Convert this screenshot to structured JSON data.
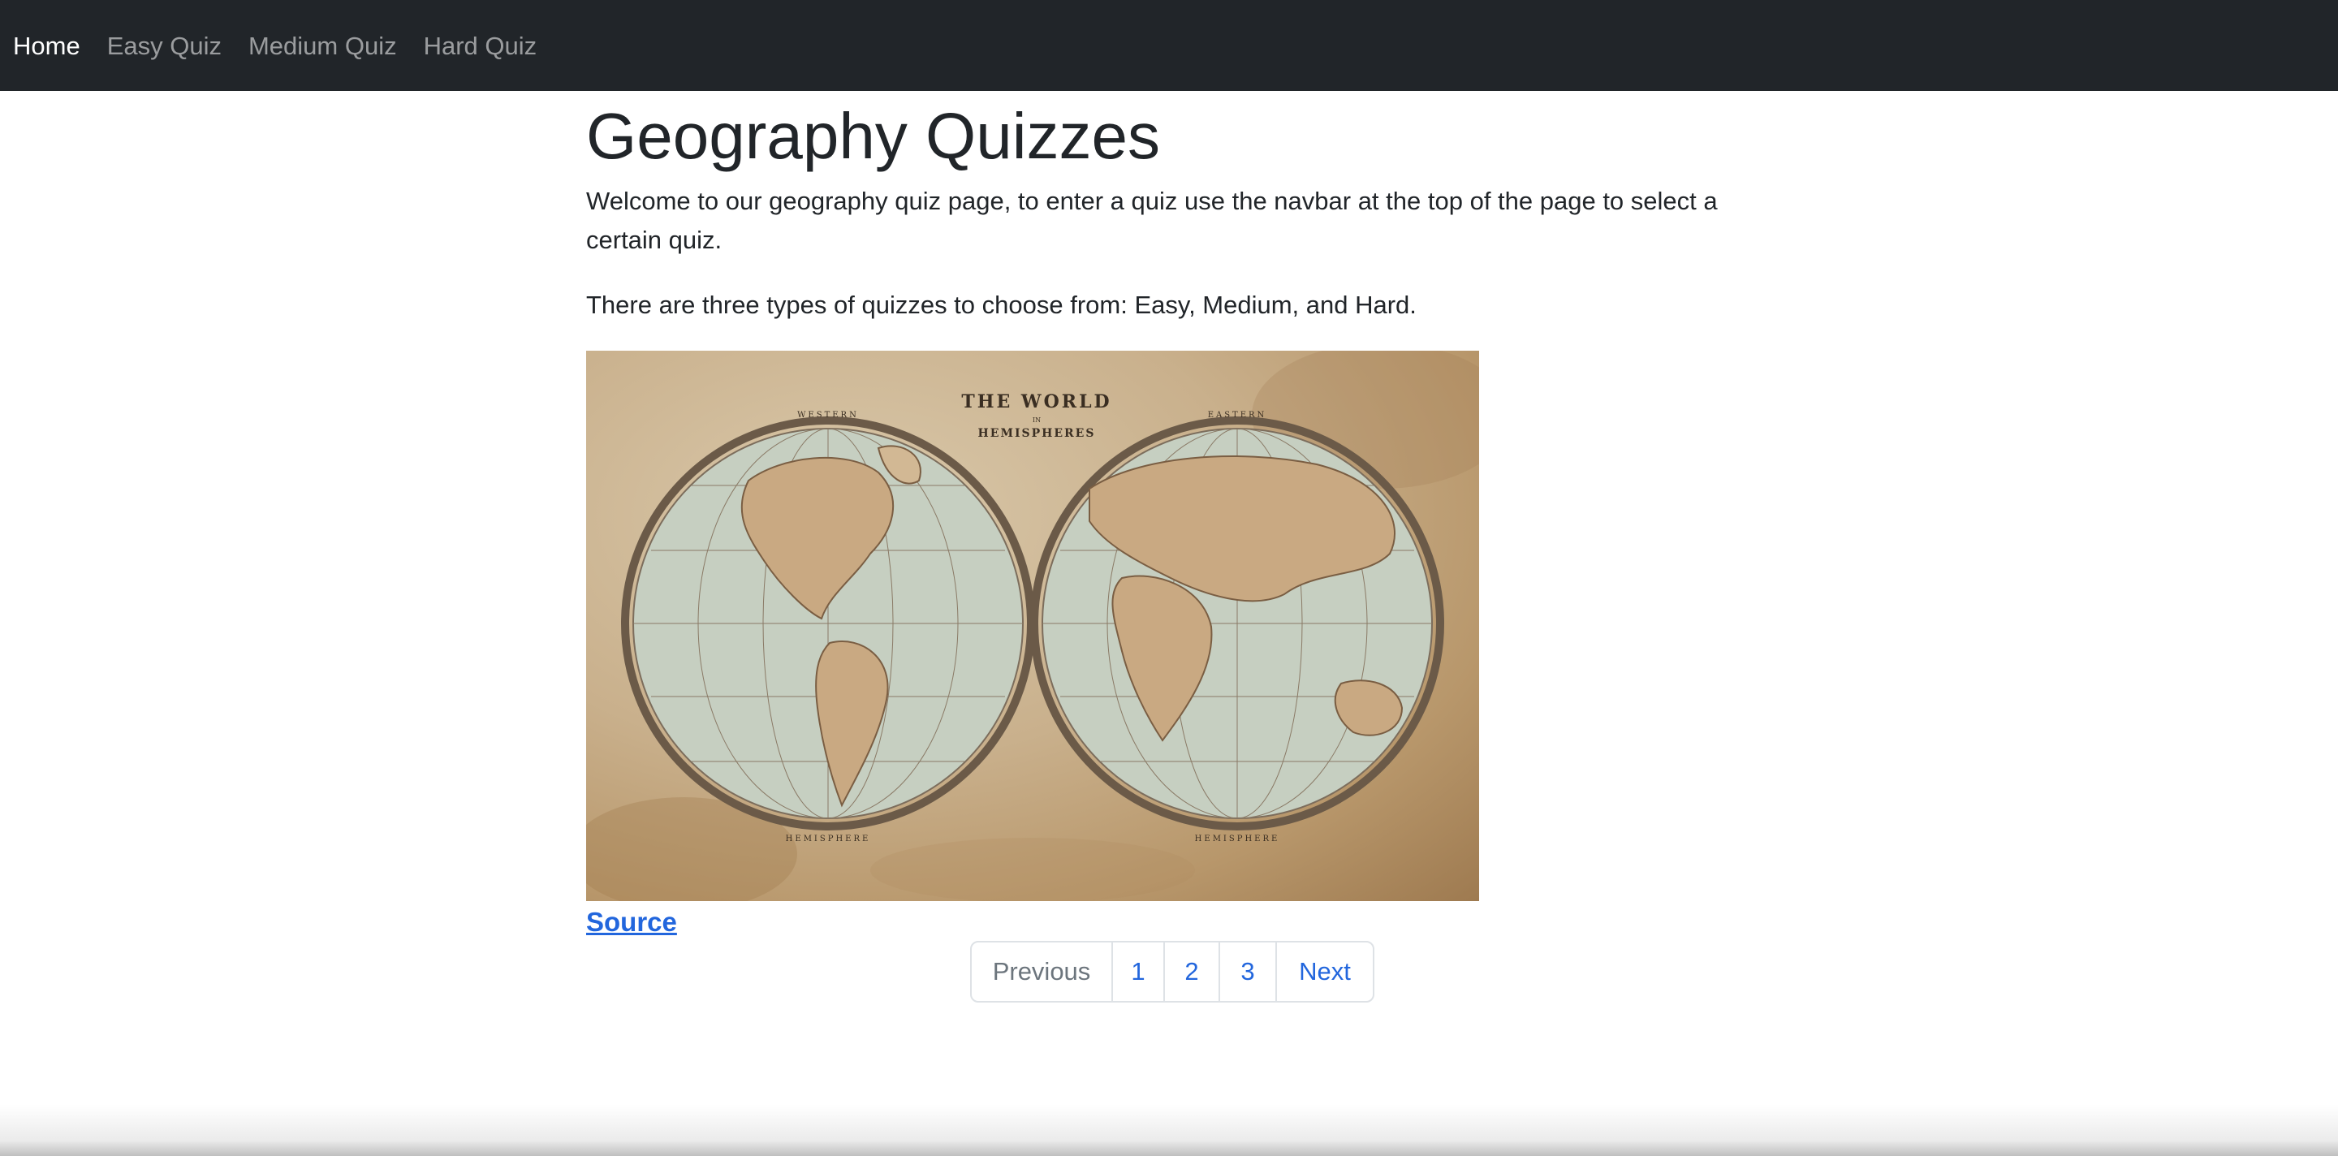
{
  "navbar": {
    "items": [
      {
        "label": "Home",
        "active": true
      },
      {
        "label": "Easy Quiz",
        "active": false
      },
      {
        "label": "Medium Quiz",
        "active": false
      },
      {
        "label": "Hard Quiz",
        "active": false
      }
    ]
  },
  "main": {
    "title": "Geography Quizzes",
    "intro": "Welcome to our geography quiz page, to enter a quiz use the navbar at the top of the page to select a certain quiz.",
    "types": "There are three types of quizzes to choose from: Easy, Medium, and Hard.",
    "image": {
      "title": "THE WORLD",
      "subtitle_in": "IN",
      "subtitle": "HEMISPHERES",
      "west_label": "WESTERN",
      "east_label": "EASTERN",
      "bottom_label": "HEMISPHERE"
    },
    "source_label": "Source"
  },
  "pagination": {
    "previous": "Previous",
    "pages": [
      "1",
      "2",
      "3"
    ],
    "next": "Next"
  },
  "colors": {
    "navbar_bg": "#212529",
    "link": "#2266dd",
    "text": "#212529"
  }
}
